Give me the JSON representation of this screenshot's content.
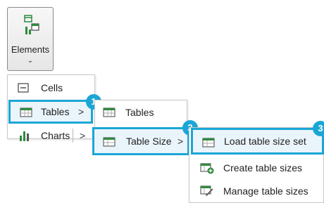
{
  "ribbon": {
    "elements_label": "Elements",
    "chevron": "⌄"
  },
  "menu1": {
    "items": [
      {
        "label": "Cells",
        "icon": "cells-icon"
      },
      {
        "label": "Tables",
        "icon": "table-icon",
        "arrow": ">"
      },
      {
        "label": "Charts",
        "icon": "bar-chart-icon",
        "arrow": ">"
      }
    ]
  },
  "menu2": {
    "items": [
      {
        "label": "Tables",
        "icon": "table-icon"
      },
      {
        "label": "Table Size",
        "icon": "table-size-icon",
        "arrow": ">"
      }
    ]
  },
  "menu3": {
    "items": [
      {
        "label": "Load table size set",
        "icon": "load-table-size-icon"
      },
      {
        "label": "Create table sizes",
        "icon": "create-table-size-icon"
      },
      {
        "label": "Manage table sizes",
        "icon": "manage-table-size-icon"
      }
    ]
  },
  "badges": [
    "1",
    "2",
    "3"
  ],
  "colors": {
    "accent": "#1ba6d6",
    "icon_green": "#2e8b3e",
    "highlight_bg": "#eaf4fb"
  }
}
